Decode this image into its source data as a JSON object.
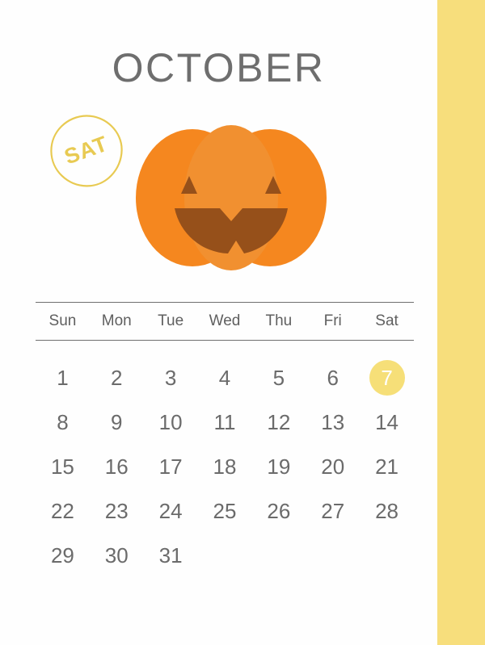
{
  "page": {
    "month_title": "OCTOBER",
    "accent_color": "#f7de7c",
    "title_color": "#6e6e6e",
    "day_text_color": "#6b6b6b",
    "background": "#fefefe"
  },
  "stamp": {
    "label": "SAT",
    "icon": "circle-stamp-icon",
    "color": "#e8ca52"
  },
  "illustration": {
    "name": "jack-o-lantern-pumpkin",
    "body_color": "#f5871f",
    "center_lobe_color": "#f19030",
    "face_color": "#96501a"
  },
  "weekdays": [
    "Sun",
    "Mon",
    "Tue",
    "Wed",
    "Thu",
    "Fri",
    "Sat"
  ],
  "weeks": [
    [
      "1",
      "2",
      "3",
      "4",
      "5",
      "6",
      "7"
    ],
    [
      "8",
      "9",
      "10",
      "11",
      "12",
      "13",
      "14"
    ],
    [
      "15",
      "16",
      "17",
      "18",
      "19",
      "20",
      "21"
    ],
    [
      "22",
      "23",
      "24",
      "25",
      "26",
      "27",
      "28"
    ],
    [
      "29",
      "30",
      "31",
      "",
      "",
      "",
      ""
    ]
  ],
  "highlighted_day": "7",
  "highlight_color": "#f6df78",
  "highlight_text_color": "#ffffff"
}
